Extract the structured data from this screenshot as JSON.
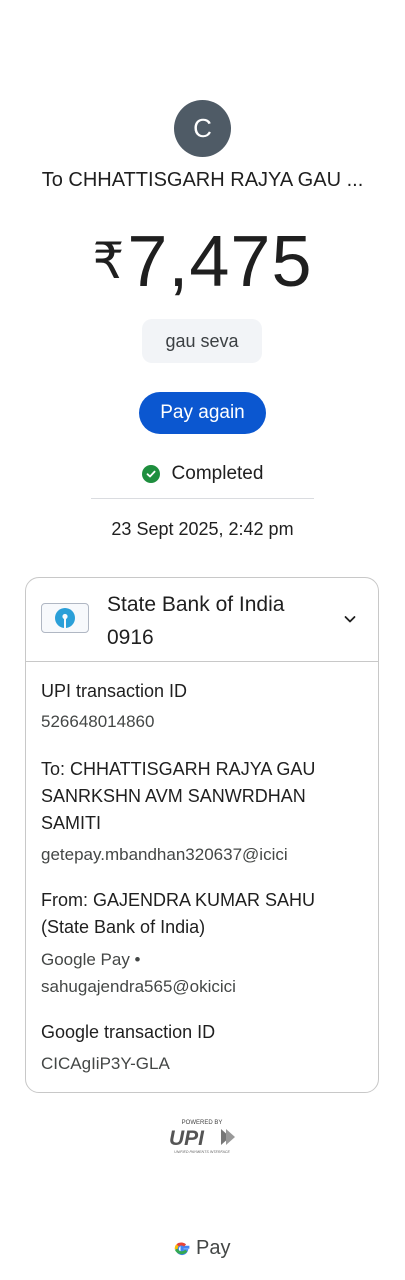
{
  "avatar": {
    "initial": "C"
  },
  "recipient_title": "To CHHATTISGARH RAJYA GAU ...",
  "amount": {
    "currency_symbol": "₹",
    "value": "7,475"
  },
  "note": "gau seva",
  "pay_again_label": "Pay again",
  "status": {
    "label": "Completed",
    "color": "#1e8e3e"
  },
  "datetime": "23 Sept 2025, 2:42 pm",
  "account": {
    "bank_name": "State Bank of India",
    "account_suffix": "0916",
    "logo_icon": "sbi-logo-icon",
    "expand_icon": "chevron-down-icon"
  },
  "details": {
    "upi_id_label": "UPI transaction ID",
    "upi_id_value": "526648014860",
    "to_line1": "To: CHHATTISGARH RAJYA GAU",
    "to_line2": "SANRKSHN AVM SANWRDHAN",
    "to_line3": "SAMITI",
    "to_vpa": "getepay.mbandhan320637@icici",
    "from_line1": "From: GAJENDRA KUMAR  SAHU",
    "from_line2": "(State Bank of India)",
    "from_app": "Google Pay •",
    "from_vpa": "sahugajendra565@okicici",
    "google_id_label": "Google transaction ID",
    "google_id_value": "CICAgIiP3Y-GLA"
  },
  "footer": {
    "upi_powered_by": "POWERED BY",
    "upi_text": "UPI",
    "upi_tagline": "UNIFIED PAYMENTS INTERFACE",
    "gpay_label": "Pay",
    "gpay_icon": "google-g-icon"
  },
  "colors": {
    "accent": "#0b57d0",
    "avatar_bg": "#4f5b66",
    "text": "#1f1f1f",
    "secondary": "#444746",
    "border": "#c8c8c8"
  }
}
